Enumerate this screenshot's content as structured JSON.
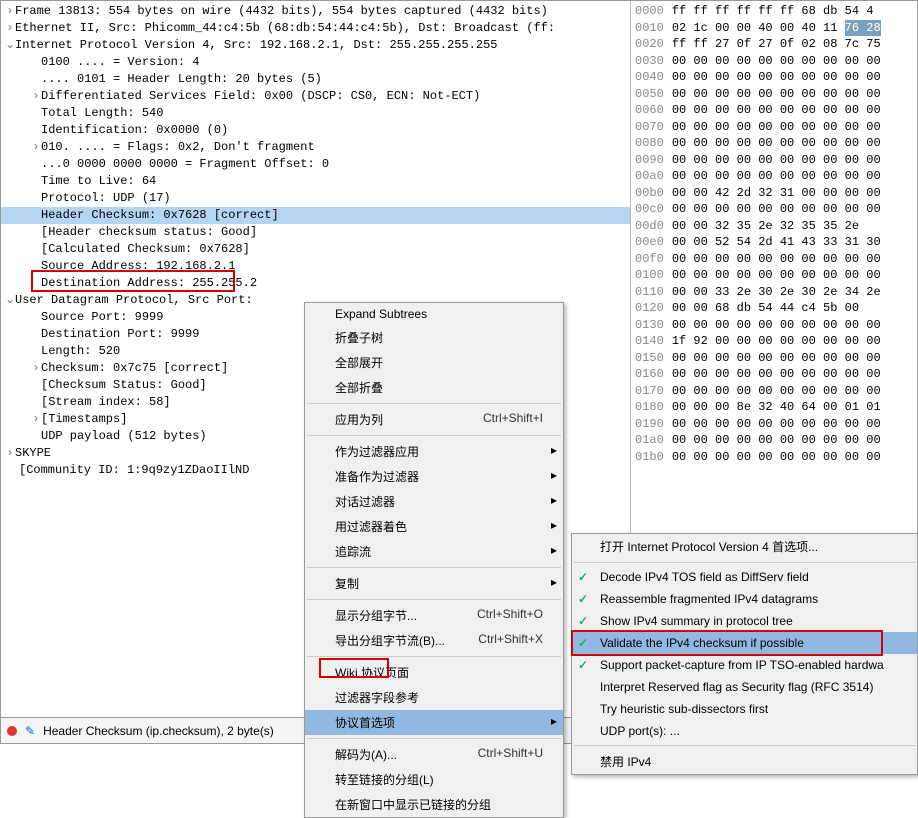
{
  "tree": {
    "frame": "Frame 13813: 554 bytes on wire (4432 bits), 554 bytes captured (4432 bits)",
    "eth": "Ethernet II, Src: Phicomm_44:c4:5b (68:db:54:44:c4:5b), Dst: Broadcast (ff:",
    "ip": "Internet Protocol Version 4, Src: 192.168.2.1, Dst: 255.255.255.255",
    "ip_version": "0100 .... = Version: 4",
    "ip_hdrlen": ".... 0101 = Header Length: 20 bytes (5)",
    "ip_dsf": "Differentiated Services Field: 0x00 (DSCP: CS0, ECN: Not-ECT)",
    "ip_len": "Total Length: 540",
    "ip_id": "Identification: 0x0000 (0)",
    "ip_flags": "010. .... = Flags: 0x2, Don't fragment",
    "ip_fo": "...0 0000 0000 0000 = Fragment Offset: 0",
    "ip_ttl": "Time to Live: 64",
    "ip_proto": "Protocol: UDP (17)",
    "ip_chksum": "Header Checksum: 0x7628",
    "ip_chksum_suffix": " [correct]",
    "ip_chksum_status": "[Header checksum status: Good]",
    "ip_chksum_calc": "[Calculated Checksum: 0x7628]",
    "ip_src": "Source Address: 192.168.2.1",
    "ip_dst": "Destination Address: 255.255.2",
    "udp": "User Datagram Protocol, Src Port:",
    "udp_srcport": "Source Port: 9999",
    "udp_dstport": "Destination Port: 9999",
    "udp_len": "Length: 520",
    "udp_chksum": "Checksum: 0x7c75 [correct]",
    "udp_chksum_status": "[Checksum Status: Good]",
    "udp_stream": "[Stream index: 58]",
    "udp_ts": "[Timestamps]",
    "udp_payload": "UDP payload (512 bytes)",
    "skype": "SKYPE",
    "comm": "[Community ID: 1:9q9zy1ZDaoIIlND"
  },
  "hex": {
    "rows": [
      {
        "o": "0000",
        "b": "ff ff ff ff ff ff 68 db",
        "r": "54 4"
      },
      {
        "o": "0010",
        "b": "02 1c 00 00 40 00 40 11",
        "r": "76 28",
        "rsel": true
      },
      {
        "o": "0020",
        "b": "ff ff 27 0f 27 0f 02 08",
        "r": "7c 75"
      },
      {
        "o": "0030",
        "b": "00 00 00 00 00 00 00 00",
        "r": "00 00"
      },
      {
        "o": "0040",
        "b": "00 00 00 00 00 00 00 00",
        "r": "00 00"
      },
      {
        "o": "0050",
        "b": "00 00 00 00 00 00 00 00",
        "r": "00 00"
      },
      {
        "o": "0060",
        "b": "00 00 00 00 00 00 00 00",
        "r": "00 00"
      },
      {
        "o": "0070",
        "b": "00 00 00 00 00 00 00 00",
        "r": "00 00"
      },
      {
        "o": "0080",
        "b": "00 00 00 00 00 00 00 00",
        "r": "00 00"
      },
      {
        "o": "0090",
        "b": "00 00 00 00 00 00 00 00",
        "r": "00 00"
      },
      {
        "o": "00a0",
        "b": "00 00 00 00 00 00 00 00",
        "r": "00 00"
      },
      {
        "o": "00b0",
        "b": "00 00 42 2d 32 31 00 00",
        "r": "00 00"
      },
      {
        "o": "00c0",
        "b": "00 00 00 00 00 00 00 00",
        "r": "00 00"
      },
      {
        "o": "00d0",
        "b": "00 00 32 35 2e 32 35",
        "r": "35 2e"
      },
      {
        "o": "00e0",
        "b": "00 00 52 54 2d 41 43 33",
        "r": "31 30"
      },
      {
        "o": "00f0",
        "b": "00 00 00 00 00 00 00 00",
        "r": "00 00"
      },
      {
        "o": "0100",
        "b": "00 00 00 00 00 00 00 00",
        "r": "00 00"
      },
      {
        "o": "0110",
        "b": "00 00 33 2e 30 2e 30 2e",
        "r": "34 2e"
      },
      {
        "o": "0120",
        "b": "00 00 68 db 54 44 c4",
        "r": "5b 00"
      },
      {
        "o": "0130",
        "b": "00 00 00 00 00 00 00 00",
        "r": "00 00"
      },
      {
        "o": "0140",
        "b": "1f 92 00 00 00 00 00 00",
        "r": "00 00"
      },
      {
        "o": "0150",
        "b": "00 00 00 00 00 00 00 00",
        "r": "00 00"
      },
      {
        "o": "0160",
        "b": "00 00 00 00 00 00 00 00",
        "r": "00 00"
      },
      {
        "o": "0170",
        "b": "00 00 00 00 00 00 00 00",
        "r": "00 00"
      },
      {
        "o": "0180",
        "b": "00 00 00 8e 32 40 64 00",
        "r": "01 01"
      },
      {
        "o": "0190",
        "b": "00 00 00 00 00 00 00 00",
        "r": "00 00"
      },
      {
        "o": "01a0",
        "b": "00 00 00 00 00 00 00 00",
        "r": "00 00"
      },
      {
        "o": "01b0",
        "b": "00 00 00 00 00 00 00 00",
        "r": "00 00"
      }
    ]
  },
  "menu1": {
    "expand_subtrees": "Expand Subtrees",
    "collapse_subtrees": "折叠子树",
    "expand_all": "全部展开",
    "collapse_all": "全部折叠",
    "apply_as_column": "应用为列",
    "apply_as_column_sc": "Ctrl+Shift+I",
    "apply_as_filter": "作为过滤器应用",
    "prepare_as_filter": "准备作为过滤器",
    "conversation_filter": "对话过滤器",
    "colorize_with_filter": "用过滤器着色",
    "follow": "追踪流",
    "copy": "复制",
    "show_packet_bytes": "显示分组字节...",
    "show_packet_bytes_sc": "Ctrl+Shift+O",
    "export_packet_bytes": "导出分组字节流(B)...",
    "export_packet_bytes_sc": "Ctrl+Shift+X",
    "wiki": "Wiki 协议页面",
    "filter_field_ref": "过滤器字段参考",
    "proto_prefs": "协议首选项",
    "decode_as": "解码为(A)...",
    "decode_as_sc": "Ctrl+Shift+U",
    "goto_linked": "转至链接的分组(L)",
    "show_linked": "在新窗口中显示已链接的分组"
  },
  "menu2": {
    "open_prefs": "打开 Internet Protocol Version 4 首选项...",
    "decode_tos": "Decode IPv4 TOS field as DiffServ field",
    "reassemble": "Reassemble fragmented IPv4 datagrams",
    "show_summary": "Show IPv4 summary in protocol tree",
    "validate_checksum": "Validate the IPv4 checksum if possible",
    "support_tso": "Support packet-capture from IP TSO-enabled hardwa",
    "interpret_reserved": "Interpret Reserved flag as Security flag (RFC 3514)",
    "heuristic": "Try heuristic sub-dissectors first",
    "udp_ports": "UDP port(s): ...",
    "disable": "禁用 IPv4"
  },
  "status": {
    "text": "Header Checksum (ip.checksum), 2 byte(s)"
  }
}
